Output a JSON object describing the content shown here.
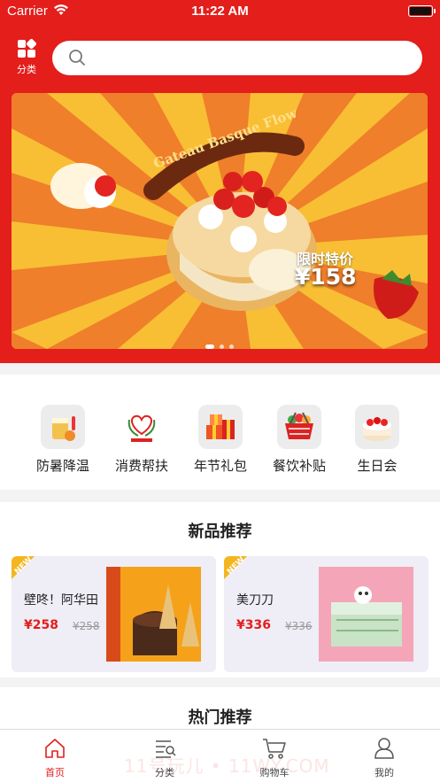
{
  "status_bar": {
    "carrier": "Carrier",
    "time": "11:22 AM"
  },
  "header": {
    "category_label": "分类",
    "search": {
      "placeholder": "",
      "value": ""
    }
  },
  "banner": {
    "headline": "Gateau Basque Flow",
    "promo_label": "限时特价",
    "promo_price": "¥158",
    "slide_count": 3,
    "active_slide": 1
  },
  "categories": [
    {
      "label": "防暑降温",
      "icon": "iced-drink-icon"
    },
    {
      "label": "消费帮扶",
      "icon": "consumption-aid-icon"
    },
    {
      "label": "年节礼包",
      "icon": "gift-box-icon"
    },
    {
      "label": "餐饮补贴",
      "icon": "shopping-basket-icon"
    },
    {
      "label": "生日会",
      "icon": "birthday-cake-icon"
    }
  ],
  "new_products": {
    "title": "新品推荐",
    "ribbon": "NEW",
    "items": [
      {
        "name": "壁咚！阿华田",
        "price": "¥258",
        "original_price": "¥258"
      },
      {
        "name": "美刀刀",
        "price": "¥336",
        "original_price": "¥336"
      }
    ]
  },
  "hot_products": {
    "title": "热门推荐"
  },
  "watermark": "11号玩儿 • 11WY.COM",
  "tabbar": [
    {
      "label": "首页",
      "icon": "home-icon",
      "active": true
    },
    {
      "label": "分类",
      "icon": "category-list-icon",
      "active": false
    },
    {
      "label": "购物车",
      "icon": "cart-icon",
      "active": false
    },
    {
      "label": "我的",
      "icon": "user-icon",
      "active": false
    }
  ],
  "colors": {
    "brand_red": "#e31e1b",
    "price_red": "#e31e1b",
    "banner_orange": "#f0a430"
  }
}
